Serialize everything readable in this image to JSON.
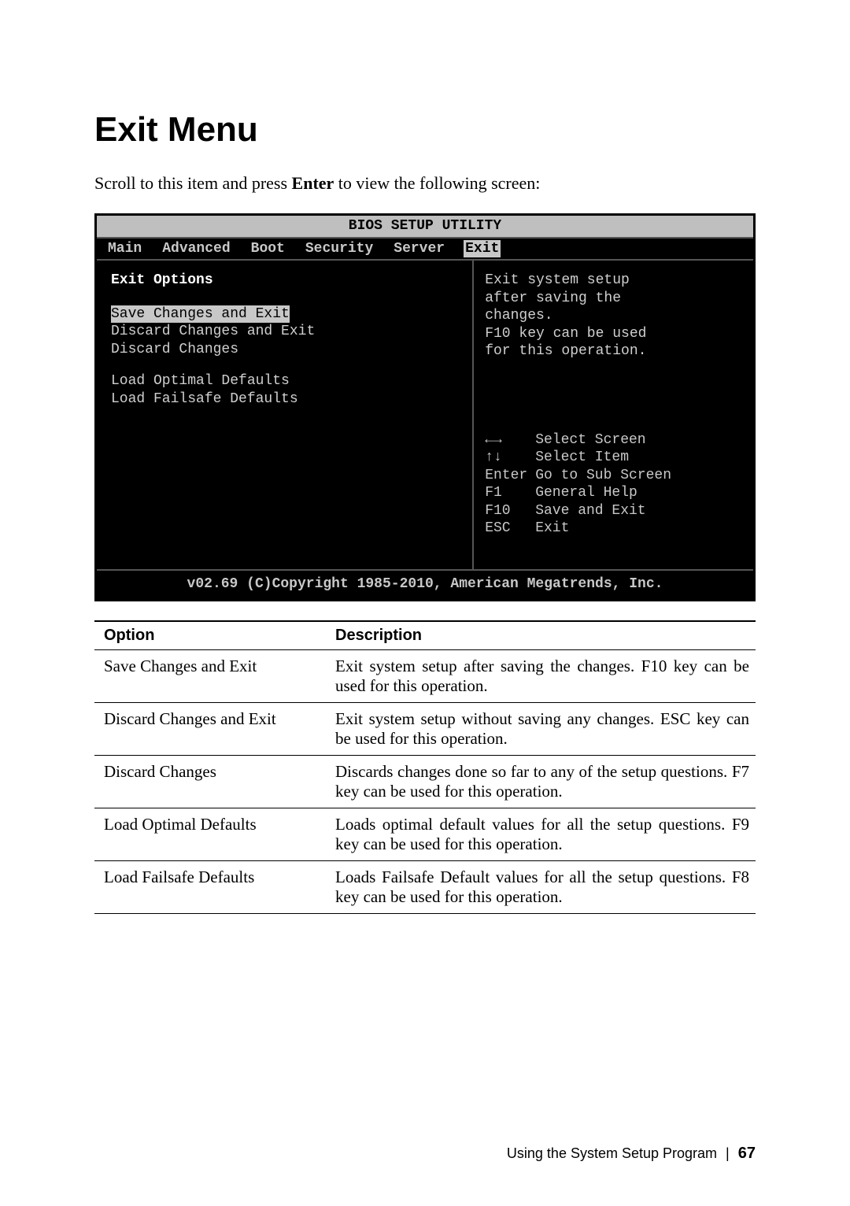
{
  "page": {
    "title": "Exit Menu",
    "instruction_pre": "Scroll to this item and press ",
    "instruction_bold": "Enter",
    "instruction_post": " to view the following screen:"
  },
  "bios": {
    "title": "BIOS SETUP UTILITY",
    "tabs": [
      "Main",
      "Advanced",
      "Boot",
      "Security",
      "Server",
      "Exit"
    ],
    "selected_tab": "Exit",
    "left": {
      "heading": "Exit Options",
      "options_group1": [
        "Save Changes and Exit",
        "Discard Changes and Exit",
        "Discard Changes"
      ],
      "options_group2": [
        "Load Optimal Defaults",
        "Load Failsafe Defaults"
      ],
      "selected_option": "Save Changes and Exit"
    },
    "right": {
      "help_lines": [
        "Exit system setup",
        "after saving the",
        "changes.",
        "",
        "F10 key can be used",
        "for this operation."
      ],
      "keys": [
        {
          "key": "←→",
          "action": "Select Screen"
        },
        {
          "key": "↑↓",
          "action": "Select Item"
        },
        {
          "key": "Enter",
          "action": "Go to Sub Screen"
        },
        {
          "key": "F1",
          "action": "General Help"
        },
        {
          "key": "F10",
          "action": "Save and Exit"
        },
        {
          "key": "ESC",
          "action": "Exit"
        }
      ]
    },
    "footer": "v02.69 (C)Copyright 1985-2010, American Megatrends, Inc."
  },
  "table": {
    "headers": [
      "Option",
      "Description"
    ],
    "rows": [
      {
        "option": "Save Changes and Exit",
        "desc": "Exit system setup after saving the changes. F10 key can be used for this operation."
      },
      {
        "option": "Discard Changes and Exit",
        "desc": "Exit system setup without saving any changes. ESC key can be used for this operation."
      },
      {
        "option": "Discard Changes",
        "desc": "Discards changes done so far to any of the setup questions. F7 key can be used for this operation."
      },
      {
        "option": "Load Optimal Defaults",
        "desc": "Loads optimal default values for all the setup questions. F9 key can be used for this operation."
      },
      {
        "option": "Load Failsafe Defaults",
        "desc": "Loads Failsafe Default values for all the setup questions. F8 key can be used for this operation."
      }
    ]
  },
  "footer": {
    "text": "Using the System Setup Program",
    "page_number": "67"
  }
}
